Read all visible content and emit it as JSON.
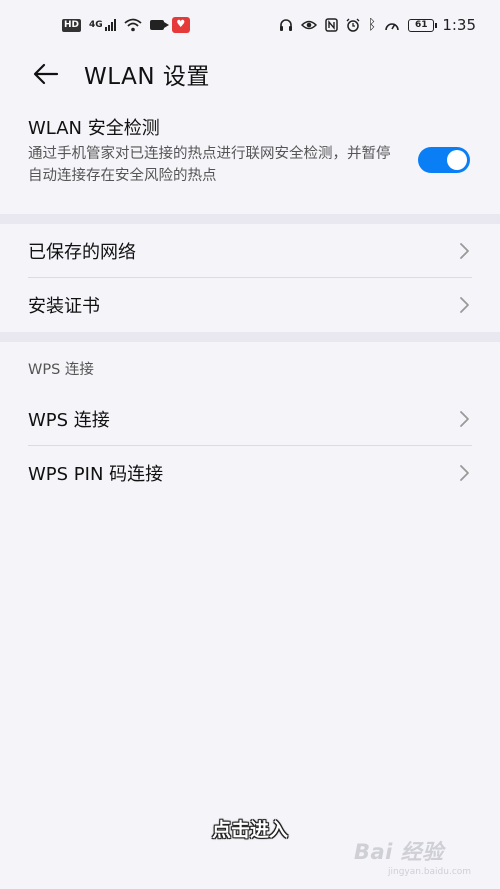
{
  "status_bar": {
    "network_badge": "HD",
    "network_type": "4G",
    "battery_level": "61",
    "time": "1:35",
    "icons": [
      "headset-icon",
      "eye-comfort-icon",
      "nfc-icon",
      "alarm-icon",
      "bluetooth-icon",
      "gauge-icon"
    ]
  },
  "header": {
    "back_icon": "arrow-left-icon",
    "title": "WLAN 设置"
  },
  "security_check": {
    "title": "WLAN 安全检测",
    "description": "通过手机管家对已连接的热点进行联网安全检测，并暂停自动连接存在安全风险的热点",
    "enabled": true
  },
  "menu_items": [
    {
      "label": "已保存的网络"
    },
    {
      "label": "安装证书"
    }
  ],
  "wps_group": {
    "title": "WPS 连接",
    "items": [
      {
        "label": "WPS 连接"
      },
      {
        "label": "WPS PIN 码连接"
      }
    ]
  },
  "overlay": {
    "caption": "点击进入",
    "watermark_logo": "Bai 经验",
    "watermark_url": "jingyan.baidu.com"
  },
  "colors": {
    "accent": "#0a7ff5",
    "background": "#f5f4f9",
    "separator": "#e9e8f1"
  }
}
